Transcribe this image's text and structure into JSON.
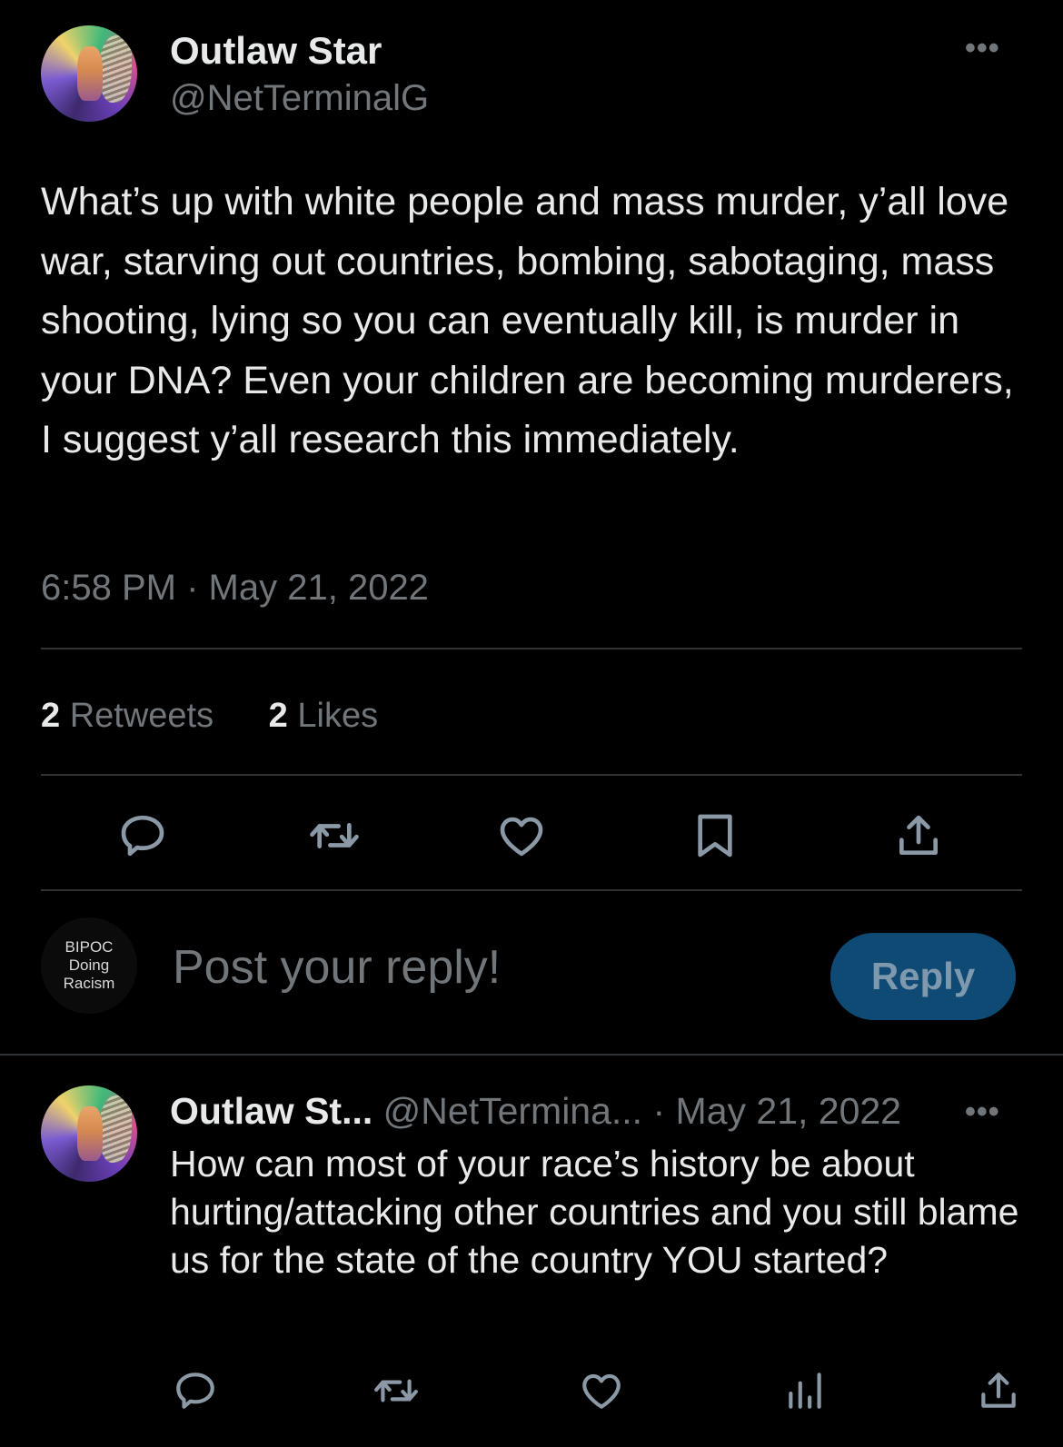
{
  "main_tweet": {
    "author_name": "Outlaw Star",
    "author_handle": "@NetTerminalG",
    "more_label": "•••",
    "text": "What’s up with white people and mass murder, y’all love war, starving out countries, bombing, sabotaging, mass shooting, lying so you can eventually kill, is murder in your DNA? Even your children are becoming murderers, I suggest y’all research this immediately.",
    "time": "6:58 PM",
    "date": "May 21, 2022",
    "separator": "·"
  },
  "stats": {
    "retweets_count": "2",
    "retweets_label": "Retweets",
    "likes_count": "2",
    "likes_label": "Likes"
  },
  "actions": {
    "icons": [
      "comment-icon",
      "retweet-icon",
      "heart-icon",
      "bookmark-icon",
      "share-icon"
    ]
  },
  "composer": {
    "avatar_line1": "BIPOC",
    "avatar_line2": "Doing",
    "avatar_line3": "Racism",
    "placeholder": "Post your reply!",
    "reply_button": "Reply"
  },
  "reply_tweet": {
    "author_name": "Outlaw St...",
    "author_handle": "@NetTermina...",
    "separator": "·",
    "date": "May 21, 2022",
    "more_label": "•••",
    "text": "How can most of your race’s history be about hurting/attacking other countries and you still blame us for the state of the country YOU started?",
    "icons": [
      "comment-icon",
      "retweet-icon",
      "heart-icon",
      "views-icon",
      "share-icon"
    ]
  },
  "colors": {
    "background": "#000000",
    "text_primary": "#e7e9ea",
    "text_secondary": "#71767b",
    "divider": "#2f3336",
    "reply_button_bg": "#0e4a74"
  }
}
